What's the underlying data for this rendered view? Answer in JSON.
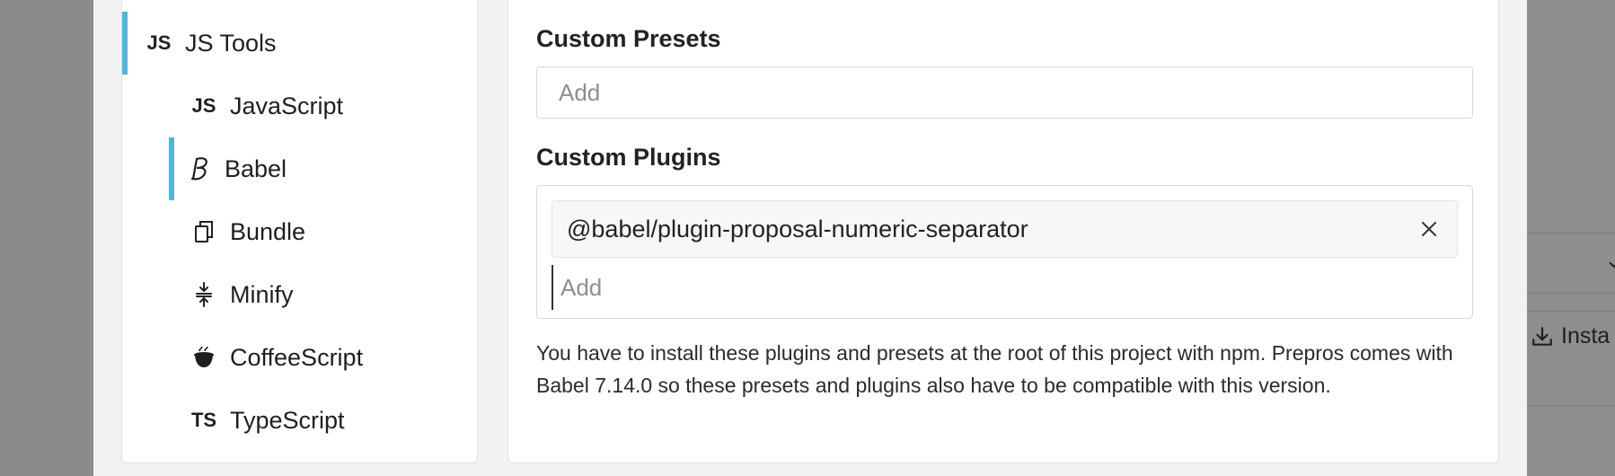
{
  "sidebar": {
    "items": [
      {
        "label": "JS Tools",
        "icon": "js-icon",
        "icon_text": "JS",
        "active": true
      },
      {
        "label": "JavaScript",
        "icon": "js-icon",
        "icon_text": "JS"
      },
      {
        "label": "Babel",
        "icon": "babel-icon",
        "active": true
      },
      {
        "label": "Bundle",
        "icon": "bundle-icon"
      },
      {
        "label": "Minify",
        "icon": "minify-icon"
      },
      {
        "label": "CoffeeScript",
        "icon": "coffee-icon"
      },
      {
        "label": "TypeScript",
        "icon": "ts-icon",
        "icon_text": "TS"
      }
    ]
  },
  "content": {
    "custom_presets": {
      "label": "Custom Presets",
      "placeholder": "Add",
      "value": ""
    },
    "custom_plugins": {
      "label": "Custom Plugins",
      "tags": [
        "@babel/plugin-proposal-numeric-separator"
      ],
      "placeholder": "Add"
    },
    "help_text": "You have to install these plugins and presets at the root of this project with npm. Prepros comes with Babel 7.14.0 so these presets and plugins also have to be compatible with this version."
  },
  "background": {
    "install_label": "Insta"
  },
  "colors": {
    "accent": "#4fb6e0",
    "overlay": "#8a8a8a"
  }
}
